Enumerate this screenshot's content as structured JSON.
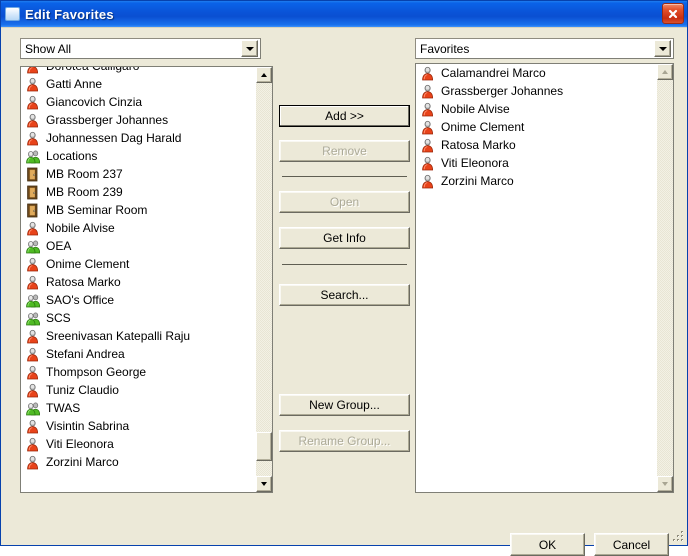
{
  "window": {
    "title": "Edit Favorites",
    "icon": "window-icon",
    "close_icon": "close-icon",
    "titlebar_color": "#0a54d8",
    "client_color": "#ece9d8"
  },
  "left_panel": {
    "filter": {
      "value": "Show All",
      "arrow_icon": "chevron-down-icon"
    },
    "items": [
      {
        "label": "Dorotea Calligaro",
        "icon": "person-icon"
      },
      {
        "label": "Gatti Anne",
        "icon": "person-icon"
      },
      {
        "label": "Giancovich Cinzia",
        "icon": "person-icon"
      },
      {
        "label": "Grassberger Johannes",
        "icon": "person-icon"
      },
      {
        "label": "Johannessen Dag Harald",
        "icon": "person-icon"
      },
      {
        "label": "Locations",
        "icon": "group-icon"
      },
      {
        "label": "MB Room 237",
        "icon": "door-icon"
      },
      {
        "label": "MB Room 239",
        "icon": "door-icon"
      },
      {
        "label": "MB Seminar Room",
        "icon": "door-icon"
      },
      {
        "label": "Nobile Alvise",
        "icon": "person-icon"
      },
      {
        "label": "OEA",
        "icon": "group-icon"
      },
      {
        "label": "Onime Clement",
        "icon": "person-icon"
      },
      {
        "label": "Ratosa Marko",
        "icon": "person-icon"
      },
      {
        "label": "SAO's Office",
        "icon": "group-icon"
      },
      {
        "label": "SCS",
        "icon": "group-icon"
      },
      {
        "label": "Sreenivasan Katepalli Raju",
        "icon": "person-icon"
      },
      {
        "label": "Stefani Andrea",
        "icon": "person-icon"
      },
      {
        "label": "Thompson George",
        "icon": "person-icon"
      },
      {
        "label": "Tuniz Claudio",
        "icon": "person-icon"
      },
      {
        "label": "TWAS",
        "icon": "group-icon"
      },
      {
        "label": "Visintin Sabrina",
        "icon": "person-icon"
      },
      {
        "label": "Viti Eleonora",
        "icon": "person-icon"
      },
      {
        "label": "Zorzini Marco",
        "icon": "person-icon"
      }
    ],
    "scrollbar": {
      "up_icon": "scroll-up-icon",
      "down_icon": "scroll-down-icon",
      "enabled": true
    }
  },
  "right_panel": {
    "filter": {
      "value": "Favorites",
      "arrow_icon": "chevron-down-icon"
    },
    "items": [
      {
        "label": "Calamandrei Marco",
        "icon": "person-icon"
      },
      {
        "label": "Grassberger Johannes",
        "icon": "person-icon"
      },
      {
        "label": "Nobile Alvise",
        "icon": "person-icon"
      },
      {
        "label": "Onime Clement",
        "icon": "person-icon"
      },
      {
        "label": "Ratosa Marko",
        "icon": "person-icon"
      },
      {
        "label": "Viti Eleonora",
        "icon": "person-icon"
      },
      {
        "label": "Zorzini Marco",
        "icon": "person-icon"
      }
    ],
    "scrollbar": {
      "up_icon": "scroll-up-icon",
      "down_icon": "scroll-down-icon",
      "enabled": false
    }
  },
  "actions": {
    "add": "Add >>",
    "remove": "Remove",
    "open": "Open",
    "get_info": "Get Info",
    "search": "Search...",
    "new_group": "New Group...",
    "rename_group": "Rename Group..."
  },
  "footer": {
    "ok": "OK",
    "cancel": "Cancel",
    "grip_icon": "resize-grip-icon"
  }
}
